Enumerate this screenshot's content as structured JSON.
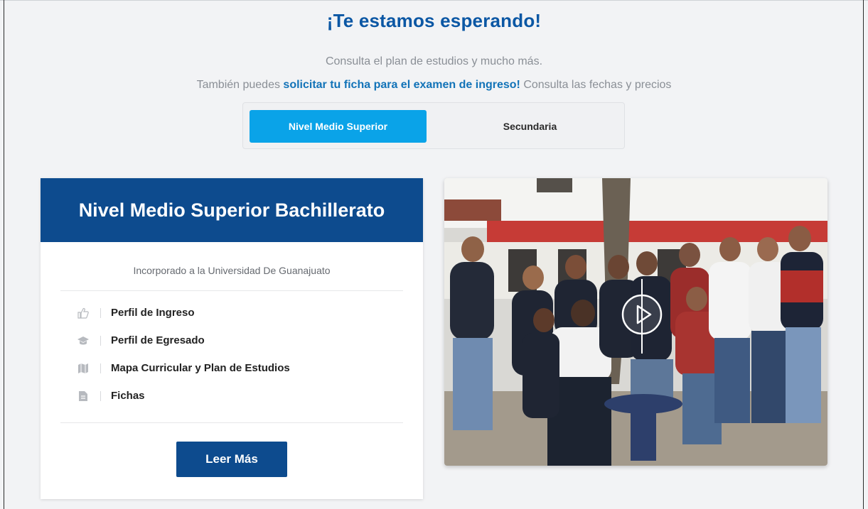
{
  "heading": "¡Te estamos esperando!",
  "intro": {
    "line1": "Consulta el plan de estudios y mucho más.",
    "line2_before": "También puedes ",
    "line2_link": "solicitar tu ficha para el examen de ingreso!",
    "line2_after": " Consulta las fechas y precios"
  },
  "tabs": [
    {
      "label": "Nivel Medio Superior",
      "active": true
    },
    {
      "label": "Secundaria",
      "active": false
    }
  ],
  "card": {
    "title": "Nivel Medio Superior Bachillerato",
    "subtitle": "Incorporado a la Universidad De Guanajuato",
    "items": [
      {
        "label": "Perfil de Ingreso",
        "icon": "thumbs-up-icon"
      },
      {
        "label": "Perfil de Egresado",
        "icon": "graduation-cap-icon"
      },
      {
        "label": "Mapa Curricular y Plan de Estudios",
        "icon": "map-icon"
      },
      {
        "label": "Fichas",
        "icon": "document-icon"
      }
    ],
    "button": "Leer Más"
  },
  "video": {
    "icon": "play-icon"
  },
  "colors": {
    "heading": "#0b57a4",
    "link": "#1273b8",
    "tab_active": "#0aa3e8",
    "card_header": "#0d4b8e",
    "button": "#0d4b8e"
  }
}
